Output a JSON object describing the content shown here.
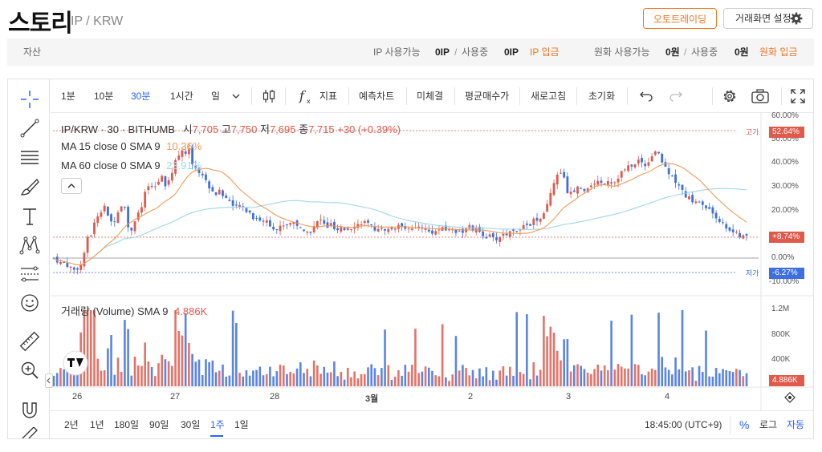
{
  "header": {
    "coin_name": "스토리",
    "pair": "IP / KRW",
    "auto_trading_label": "오토트레이딩",
    "screen_settings_label": "거래화면 설정"
  },
  "assets": {
    "label": "자산",
    "ip_available_label": "IP 사용가능",
    "ip_available_value": "0IP",
    "slash": "/",
    "ip_inuse_label": "사용중",
    "ip_inuse_value": "0IP",
    "ip_deposit_label": "IP 입금",
    "krw_available_label": "원화 사용가능",
    "krw_available_value": "0원",
    "krw_inuse_label": "사용중",
    "krw_inuse_value": "0원",
    "krw_deposit_label": "원화 입금"
  },
  "toolbar": {
    "intervals": [
      "1분",
      "10분",
      "30분",
      "1시간",
      "일"
    ],
    "active_interval": "30분",
    "indicators_label": "지표",
    "forecast_label": "예측차트",
    "unfilled_label": "미체결",
    "avg_price_label": "평균매수가",
    "refresh_label": "새로고침",
    "reset_label": "초기화"
  },
  "legend": {
    "symbol": "IP/KRW · 30 · BITHUMB",
    "open_label": "시",
    "open_value": "7,705",
    "high_label": "고",
    "high_value": "7,750",
    "low_label": "저",
    "low_value": "7,695",
    "close_label": "종",
    "close_value": "7,715",
    "change": "+30 (+0.39%)",
    "ma15_label": "MA 15 close 0 SMA 9",
    "ma15_value": "10.36%",
    "ma60_label": "MA 60 close 0 SMA 9",
    "ma60_value": "23.91%",
    "volume_label": "거래량 (Volume) SMA 9",
    "volume_value": "4.886K"
  },
  "price_axis": {
    "ticks": [
      "60.00%",
      "50.00%",
      "40.00%",
      "30.00%",
      "20.00%",
      "10.00%",
      "0.00%",
      "-10.00%"
    ],
    "high_tag": "고가",
    "high_value": "52.64%",
    "low_tag": "저가",
    "low_value": "-6.27%",
    "current_value": "+8.74%"
  },
  "volume_axis": {
    "ticks": [
      "1.2M",
      "800K",
      "400K"
    ],
    "current": "4.886K"
  },
  "time_axis": {
    "labels": [
      "26",
      "27",
      "28",
      "3월",
      "2",
      "3",
      "4"
    ]
  },
  "ranges": {
    "items": [
      "2년",
      "1년",
      "180일",
      "90일",
      "30일",
      "1주",
      "1일"
    ],
    "active": "1주",
    "time": "18:45:00 (UTC+9)",
    "percent_label": "%",
    "log_label": "로그",
    "auto_label": "자동"
  },
  "colors": {
    "up": "#e0594b",
    "down": "#3d6fe0",
    "ma15": "#f39a58",
    "ma60": "#9fd6ea",
    "accent": "#f37321",
    "active_blue": "#2962ff"
  },
  "chart_data": {
    "type": "candlestick",
    "y_scale": "percent",
    "ylim": [
      -10,
      60
    ],
    "high_pct": 52.64,
    "low_pct": -6.27,
    "last_pct": 8.74,
    "close_path_pct": [
      0,
      -1,
      -2,
      -2,
      -3,
      -4,
      -5,
      -4,
      -3,
      3,
      9,
      10,
      14,
      18,
      20,
      22,
      17,
      15,
      16,
      20,
      22,
      22,
      13,
      12,
      16,
      19,
      21,
      27,
      30,
      29,
      30,
      32,
      35,
      31,
      33,
      36,
      41,
      43,
      46,
      44,
      45,
      40,
      38,
      36,
      35,
      32,
      30,
      28,
      27,
      28,
      26,
      25,
      24,
      22,
      21,
      22,
      21,
      20,
      19,
      17,
      17,
      16,
      15,
      16,
      14,
      13,
      12,
      13,
      14,
      14,
      15,
      15,
      14,
      12,
      11,
      12,
      11,
      13,
      15,
      16,
      14,
      13,
      14,
      12,
      11,
      12,
      12,
      13,
      13,
      14,
      14,
      15,
      15,
      14,
      13,
      12,
      13,
      12,
      11,
      12,
      12,
      13,
      13,
      14,
      13,
      13,
      12,
      12,
      13,
      13,
      12,
      11,
      11,
      11,
      12,
      12,
      12,
      12,
      12,
      11,
      12,
      11,
      12,
      13,
      12,
      12,
      11,
      10,
      9,
      9,
      8,
      8,
      9,
      10,
      10,
      11,
      12,
      12,
      13,
      13,
      14,
      14,
      16,
      15,
      16,
      18,
      22,
      28,
      32,
      34,
      35,
      33,
      28,
      27,
      28,
      30,
      29,
      29,
      30,
      31,
      31,
      32,
      31,
      32,
      33,
      32,
      32,
      34,
      36,
      37,
      38,
      39,
      40,
      41,
      40,
      39,
      41,
      43,
      45,
      44,
      40,
      38,
      36,
      35,
      32,
      30,
      28,
      26,
      25,
      24,
      24,
      23,
      22,
      21,
      20,
      19,
      17,
      16,
      14,
      13,
      12,
      11,
      10,
      9,
      9,
      9
    ]
  }
}
